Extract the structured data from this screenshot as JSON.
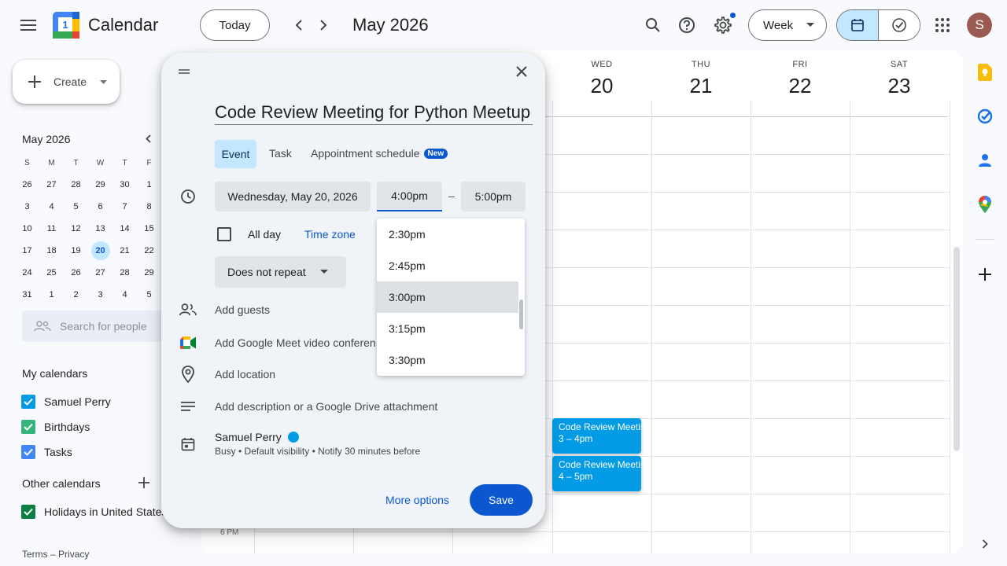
{
  "header": {
    "app_title": "Calendar",
    "logo_day": "1",
    "today_label": "Today",
    "month_title": "May 2026",
    "view_label": "Week",
    "avatar_initial": "S",
    "settings_badge_color": "#0b57d0"
  },
  "sidebar": {
    "create_label": "Create",
    "mini_month": "May 2026",
    "weekdays": [
      "S",
      "M",
      "T",
      "W",
      "T",
      "F"
    ],
    "weeks": [
      [
        "26",
        "27",
        "28",
        "29",
        "30",
        "1"
      ],
      [
        "3",
        "4",
        "5",
        "6",
        "7",
        "8"
      ],
      [
        "10",
        "11",
        "12",
        "13",
        "14",
        "15"
      ],
      [
        "17",
        "18",
        "19",
        "20",
        "21",
        "22"
      ],
      [
        "24",
        "25",
        "26",
        "27",
        "28",
        "29"
      ],
      [
        "31",
        "1",
        "2",
        "3",
        "4",
        "5"
      ]
    ],
    "selected_day": "20",
    "search_people_placeholder": "Search for people",
    "my_calendars_title": "My calendars",
    "my_calendars": [
      {
        "label": "Samuel Perry",
        "color": "#039be5"
      },
      {
        "label": "Birthdays",
        "color": "#33b679"
      },
      {
        "label": "Tasks",
        "color": "#4285f4"
      }
    ],
    "other_calendars_title": "Other calendars",
    "other_calendars": [
      {
        "label": "Holidays in United States",
        "color": "#0b8043"
      }
    ],
    "footer_terms": "Terms",
    "footer_sep": "–",
    "footer_privacy": "Privacy"
  },
  "grid": {
    "days": [
      {
        "name": "WED",
        "date": "20"
      },
      {
        "name": "THU",
        "date": "21"
      },
      {
        "name": "FRI",
        "date": "22"
      },
      {
        "name": "SAT",
        "date": "23"
      }
    ],
    "time_label_6pm": "6 PM",
    "events": [
      {
        "title": "Code Review Meeting for Python Meetup",
        "time": "3 – 4pm"
      },
      {
        "title": "Code Review Meeting for Python Meetup",
        "time": "4 – 5pm"
      }
    ]
  },
  "dialog": {
    "title_value": "Code Review Meeting for Python Meetup",
    "tabs": {
      "event": "Event",
      "task": "Task",
      "appointment": "Appointment schedule",
      "new_badge": "New"
    },
    "date_label": "Wednesday, May 20, 2026",
    "start_time": "4:00pm",
    "dash": "–",
    "end_time": "5:00pm",
    "all_day_label": "All day",
    "time_zone_label": "Time zone",
    "repeat_label": "Does not repeat",
    "add_guests": "Add guests",
    "add_meet": "Add Google Meet video conferencing",
    "add_location": "Add location",
    "add_description": "Add description or a Google Drive attachment",
    "owner_name": "Samuel Perry",
    "owner_color": "#039be5",
    "owner_details": "Busy • Default visibility • Notify 30 minutes before",
    "more_options": "More options",
    "save": "Save",
    "time_options": [
      "2:30pm",
      "2:45pm",
      "3:00pm",
      "3:15pm",
      "3:30pm"
    ],
    "highlighted_option": "3:00pm"
  }
}
